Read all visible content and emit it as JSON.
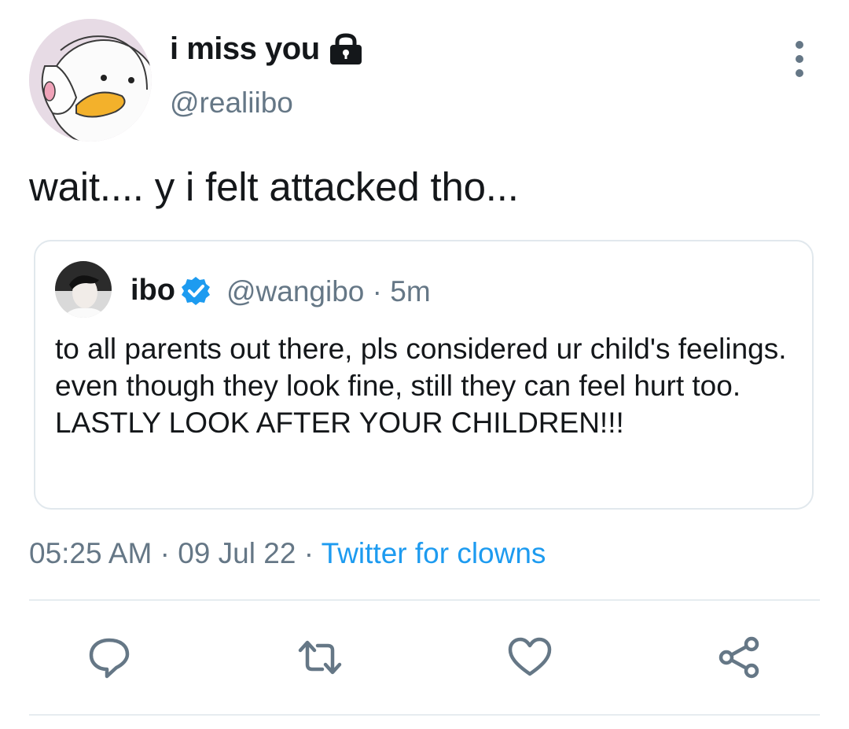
{
  "author": {
    "display_name": "i miss you",
    "handle": "@realiibo",
    "protected_icon": "lock-icon"
  },
  "more_icon": "more-vertical-icon",
  "tweet": {
    "text": "wait.... y i felt attacked tho..."
  },
  "quoted_tweet": {
    "display_name": "ibo",
    "verified_icon": "verified-badge-icon",
    "handle": "@wangibo",
    "separator": "·",
    "time": "5m",
    "text": "to all parents out there, pls considered ur child's feelings. even though they look fine, still they can feel hurt too. LASTLY LOOK AFTER YOUR CHILDREN!!!"
  },
  "meta": {
    "time": "05:25 AM",
    "sep1": "·",
    "date": "09 Jul 22",
    "sep2": "·",
    "source": "Twitter for clowns"
  },
  "actions": [
    {
      "icon": "reply-icon"
    },
    {
      "icon": "retweet-icon"
    },
    {
      "icon": "like-icon"
    },
    {
      "icon": "share-icon"
    }
  ],
  "colors": {
    "text": "#14171a",
    "secondary": "#657786",
    "link": "#1d9bf0",
    "border": "#e1e8ed"
  }
}
